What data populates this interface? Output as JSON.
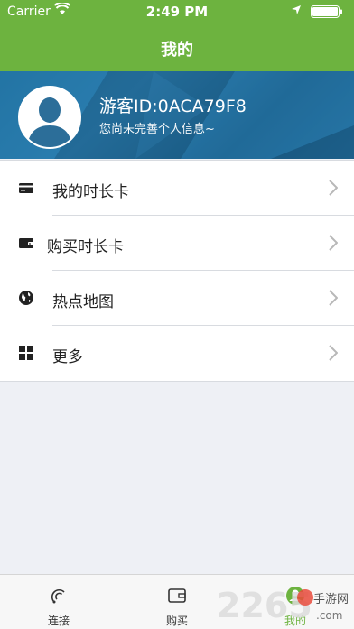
{
  "status_bar": {
    "carrier": "Carrier",
    "time": "2:49 PM"
  },
  "navbar": {
    "title": "我的"
  },
  "profile": {
    "user_id": "游客ID:0ACA79F8",
    "hint": "您尚未完善个人信息~"
  },
  "menu": {
    "items": [
      {
        "label": "我的时长卡",
        "icon": "card-icon"
      },
      {
        "label": "购买时长卡",
        "icon": "wallet-icon"
      },
      {
        "label": "热点地图",
        "icon": "globe-icon"
      },
      {
        "label": "更多",
        "icon": "grid-icon"
      }
    ]
  },
  "tabbar": {
    "items": [
      {
        "label": "连接",
        "icon": "connect-icon"
      },
      {
        "label": "购买",
        "icon": "wallet-icon"
      },
      {
        "label": "我的",
        "icon": "user-icon",
        "active": true
      }
    ]
  },
  "watermark": {
    "number": "2265",
    "site": "手游网",
    "domain": ".com"
  },
  "colors": {
    "brand": "#6db33f",
    "profile_bg": "#1f6c9a",
    "page_bg": "#eef0f5"
  }
}
